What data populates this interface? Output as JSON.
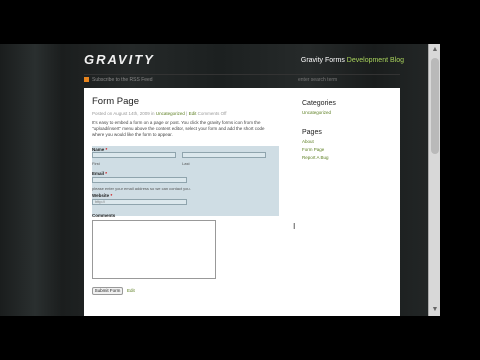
{
  "header": {
    "logo": "GRAVITY",
    "blog_title_prefix": "Gravity Forms",
    "blog_title_accent": "Development Blog"
  },
  "nav": {
    "rss_label": "Subscribe to the RSS Feed",
    "search_placeholder": "enter search term"
  },
  "post": {
    "title": "Form Page",
    "meta_date": "Posted on August 14th, 2009 in",
    "meta_category": "Uncategorized",
    "meta_sep": "|",
    "meta_edit": "Edit",
    "meta_comments": "Comments Off",
    "body": "It's easy to embed a form on a page or post. You click the gravity forms icon from the \"upload/insert\" menu above the content editor, select your form and add the short code where you would like the form to appear."
  },
  "form": {
    "name_label": "Name",
    "name_req": "*",
    "first_label": "First",
    "last_label": "Last",
    "email_label": "Email",
    "email_req": "*",
    "email_hint": "please enter your email address so we can contact you.",
    "website_label": "Website",
    "website_req": "*",
    "website_value": "http://",
    "comments_label": "Comments",
    "submit_label": "Submit Form",
    "edit_label": "Edit"
  },
  "sidebar": {
    "categories_heading": "Categories",
    "categories": [
      "Uncategorized"
    ],
    "pages_heading": "Pages",
    "pages": [
      "About",
      "Form Page",
      "Report A Bug"
    ]
  },
  "colors": {
    "accent_green": "#a9d35c",
    "link_green": "#5a7d1f",
    "form_bg": "#cfdde4",
    "rss_orange": "#e8851e"
  }
}
